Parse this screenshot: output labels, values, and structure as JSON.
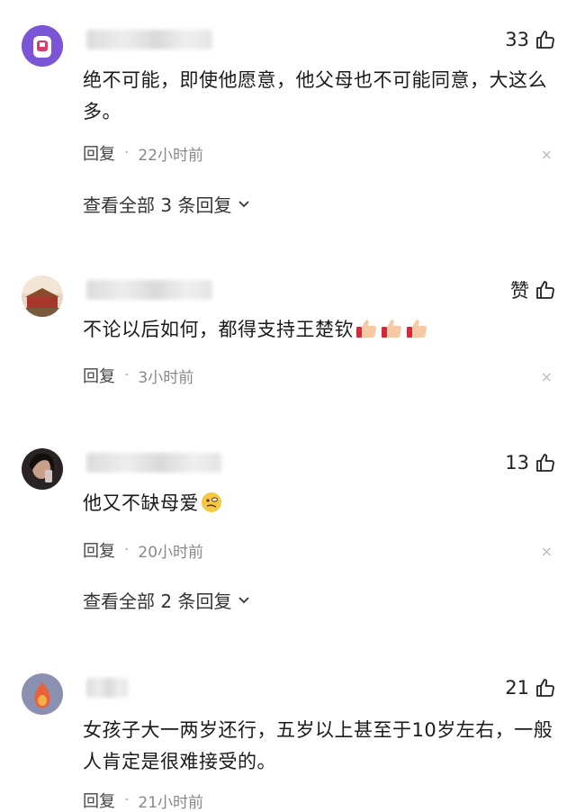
{
  "comments": [
    {
      "username_visible": "",
      "likes": "33",
      "text": "绝不可能，即使他愿意，他父母也不可能同意，大这么多。",
      "reply_label": "回复",
      "time": "22小时前",
      "close": "×",
      "view_replies": "查看全部 3 条回复"
    },
    {
      "username_visible": "",
      "likes": "赞",
      "text": "不论以后如何，都得支持王楚钦",
      "reply_label": "回复",
      "time": "3小时前",
      "close": "×"
    },
    {
      "username_visible": "",
      "likes": "13",
      "text": "他又不缺母爱",
      "reply_label": "回复",
      "time": "20小时前",
      "close": "×",
      "view_replies": "查看全部 2 条回复"
    },
    {
      "username_visible": "",
      "likes": "21",
      "text": "女孩子大一两岁还行，五岁以上甚至于10岁左右，一般人肯定是很难接受的。",
      "reply_label": "回复",
      "time": "21小时前"
    }
  ],
  "separator": "·",
  "icons": {
    "like": "thumbs-up-icon",
    "chevron": "chevron-down-icon",
    "close": "close-icon",
    "emoji_thumb": "thumbs-up-emoji",
    "emoji_face": "thinking-face-emoji"
  }
}
